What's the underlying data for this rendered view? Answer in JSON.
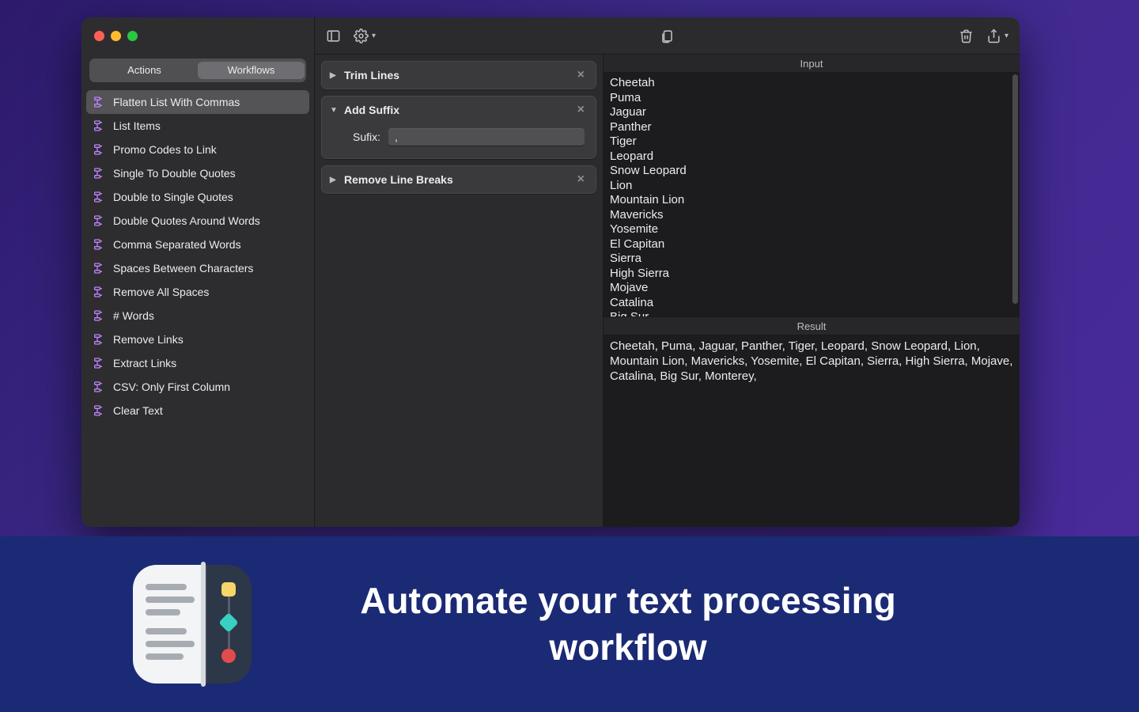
{
  "sidebar": {
    "tabs": {
      "actions": "Actions",
      "workflows": "Workflows"
    },
    "items": [
      "Flatten List With Commas",
      "List Items",
      "Promo Codes to Link",
      "Single To Double Quotes",
      "Double to Single Quotes",
      "Double Quotes Around Words",
      "Comma Separated Words",
      "Spaces Between Characters",
      "Remove All Spaces",
      "# Words",
      "Remove Links",
      "Extract Links",
      "CSV: Only First Column",
      "Clear Text"
    ],
    "selected_index": 0
  },
  "steps": [
    {
      "title": "Trim Lines",
      "expanded": false
    },
    {
      "title": "Add Suffix",
      "expanded": true,
      "field_label": "Sufix:",
      "field_value": ","
    },
    {
      "title": "Remove Line Breaks",
      "expanded": false
    }
  ],
  "io": {
    "input_label": "Input",
    "result_label": "Result",
    "input_text": "Cheetah\nPuma\nJaguar\nPanther\nTiger\nLeopard\nSnow Leopard\nLion\nMountain Lion\nMavericks\nYosemite\nEl Capitan\nSierra\nHigh Sierra\nMojave\nCatalina\nBig Sur",
    "result_text": "Cheetah, Puma, Jaguar, Panther, Tiger, Leopard, Snow Leopard, Lion, Mountain Lion, Mavericks, Yosemite, El Capitan, Sierra, High Sierra, Mojave, Catalina, Big Sur, Monterey,"
  },
  "banner": {
    "headline": "Automate your text processing workflow"
  }
}
